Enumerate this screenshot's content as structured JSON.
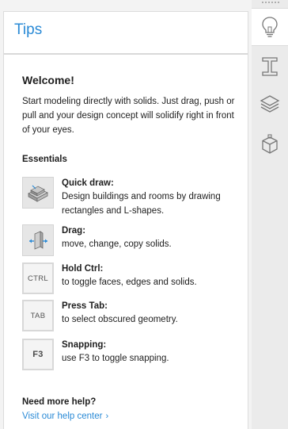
{
  "panel": {
    "title": "Tips",
    "welcome": {
      "title": "Welcome!",
      "text": "Start modeling directly with solids. Just drag, push or pull and your design concept will solidify right in front of your eyes."
    },
    "essentials_title": "Essentials",
    "tips": [
      {
        "icon": "quick-draw-icon",
        "title": "Quick draw:",
        "desc": "Design buildings and rooms by drawing rectangles and L-shapes."
      },
      {
        "icon": "drag-icon",
        "title": "Drag:",
        "desc": "move, change, copy solids."
      },
      {
        "icon": "ctrl-key-icon",
        "key": "CTRL",
        "title": "Hold Ctrl:",
        "desc": "to toggle faces, edges and solids."
      },
      {
        "icon": "tab-key-icon",
        "key": "TAB",
        "title": "Press Tab:",
        "desc": "to select obscured geometry."
      },
      {
        "icon": "f3-key-icon",
        "key": "F3",
        "title": "Snapping:",
        "desc": "use F3 to toggle snapping."
      }
    ],
    "help": {
      "title": "Need more help?",
      "link": "Visit our help center",
      "chevron": "›"
    }
  },
  "rail": {
    "tabs": [
      {
        "icon": "lightbulb-icon",
        "active": true
      },
      {
        "icon": "i-beam-icon",
        "active": false
      },
      {
        "icon": "layers-icon",
        "active": false
      },
      {
        "icon": "3d-box-icon",
        "active": false
      }
    ]
  },
  "colors": {
    "accent": "#2a8ad6",
    "background": "#f3f3f3",
    "panel": "#ffffff",
    "rail": "#ebebeb"
  }
}
